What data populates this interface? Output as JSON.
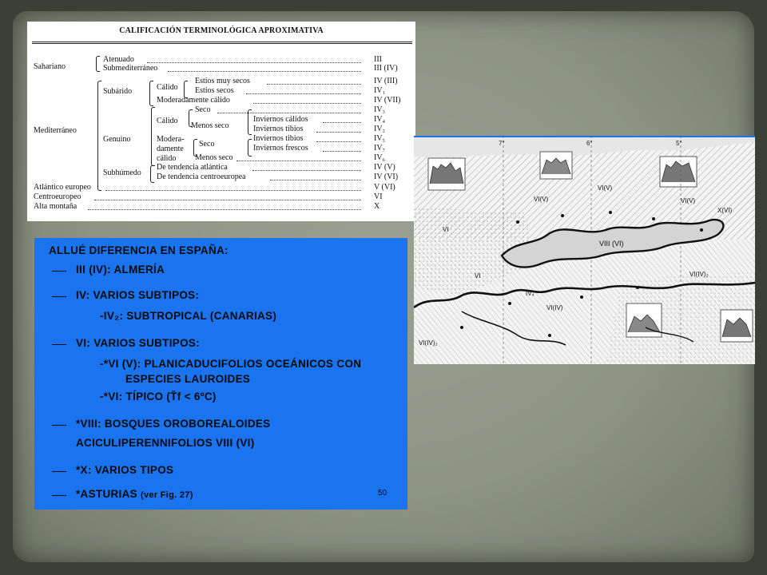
{
  "table": {
    "title": "CALIFICACIÓN TERMINOLÓGICA APROXIMATIVA",
    "rows": [
      {
        "label": "Atenuado",
        "code": "III"
      },
      {
        "label": "Submediterráneo",
        "code": "III (IV)"
      },
      {
        "label": "Estíos muy secos",
        "code": "IV (III)"
      },
      {
        "label": "Estíos secos",
        "code": "IV₁"
      },
      {
        "label": "Moderadamente cálido",
        "code": "IV (VII)"
      },
      {
        "label": "Seco",
        "code": "IV₃"
      },
      {
        "label": "Inviernos cálidos",
        "code": "IV₄"
      },
      {
        "label": "Inviernos tibios",
        "code": "IV₂"
      },
      {
        "label": "Inviernos tibios",
        "code": "IV₅"
      },
      {
        "label": "Inviernos frescos",
        "code": "IV₇"
      },
      {
        "label": "Menos seco",
        "code": "IV₆"
      },
      {
        "label": "De tendencia atlántica",
        "code": "IV (V)"
      },
      {
        "label": "De tendencia centroeuropea",
        "code": "IV (VI)"
      },
      {
        "label": "Atlántico europeo",
        "code": "V (VI)"
      },
      {
        "label": "Centroeuropeo",
        "code": "VI"
      },
      {
        "label": "Alta montaña",
        "code": "X"
      }
    ],
    "groups": {
      "sahariano": "Sahariano",
      "mediterraneo": "Mediterráneo",
      "subarido": "Subárido",
      "genuino": "Genuino",
      "subhumedo": "Subhúmedo",
      "calido1": "Cálido",
      "calido2": "Cálido",
      "menos_seco": "Menos seco",
      "moderadamente": "Modera-",
      "damente": "damente",
      "calido3": "cálido",
      "seco2": "Seco"
    }
  },
  "notes": {
    "heading": "ALLUÉ DIFERENCIA EN ESPAÑA:",
    "items": [
      "III (IV): ALMERÍA",
      "IV: VARIOS SUBTIPOS:",
      "-IV₂: SUBTROPICAL (CANARIAS)",
      "VI: VARIOS SUBTIPOS:",
      "-*VI (V): PLANICADUCIFOLIOS OCEÁNICOS CON",
      "ESPECIES LAUROIDES",
      "-*VI: TÍPICO (",
      "T̄f",
      " < 6ºC)",
      "*VIII: BOSQUES OROBOREALOIDES",
      "ACICULIPERENNIFOLIOS VIII (VI)",
      "*X: VARIOS TIPOS",
      "*ASTURIAS",
      "(ver Fig. 27)"
    ],
    "page_number": "50"
  },
  "map": {
    "longitudes": [
      "7°",
      "6°",
      "5°"
    ],
    "zone_labels": [
      "VI",
      "VI(V)",
      "VIII (VI)",
      "VI(IV)₂",
      "VI(IV)",
      "IV₄",
      "VI",
      "VI(V)",
      "VI(IV)₂",
      "X(VI)",
      "VI(V)"
    ]
  }
}
